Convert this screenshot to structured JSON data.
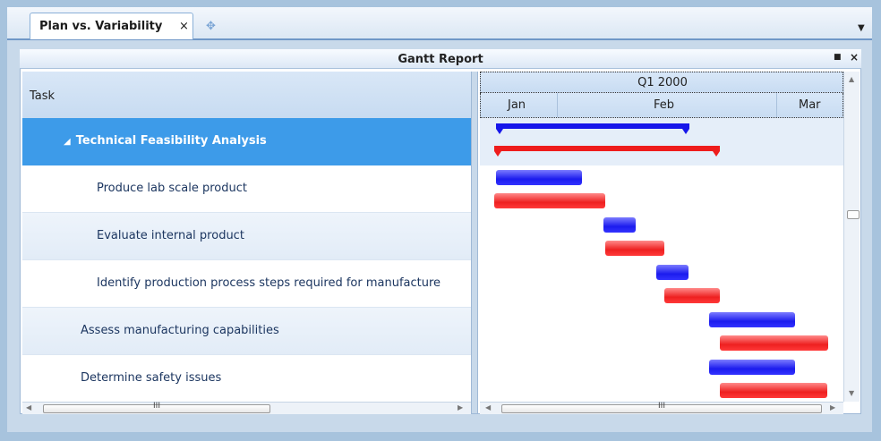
{
  "tabs": [
    {
      "label": "Plan vs. Variability",
      "close": "×"
    }
  ],
  "tab_add_icon": "✥",
  "tab_menu_icon": "▼",
  "panel": {
    "title": "Gantt Report",
    "pin_icon": "■",
    "close_icon": "×"
  },
  "grid": {
    "column_header": "Task",
    "rows": [
      {
        "label": "Technical Feasibility Analysis",
        "expander": "◢",
        "selected": true
      },
      {
        "label": "Produce lab scale product"
      },
      {
        "label": "Evaluate internal product"
      },
      {
        "label": "Identify production process steps required for manufacture"
      },
      {
        "label": "Assess manufacturing capabilities"
      },
      {
        "label": "Determine safety issues"
      }
    ]
  },
  "timeline": {
    "quarter": "Q1 2000",
    "months": [
      "Jan",
      "Feb",
      "Mar"
    ]
  },
  "colors": {
    "plan": "#1c1cee",
    "variability": "#ee2020",
    "selected_row": "#3d9be9"
  },
  "scroll_grip": "III",
  "arrows": {
    "up": "▲",
    "down": "▼",
    "left": "◀",
    "right": "▶"
  }
}
